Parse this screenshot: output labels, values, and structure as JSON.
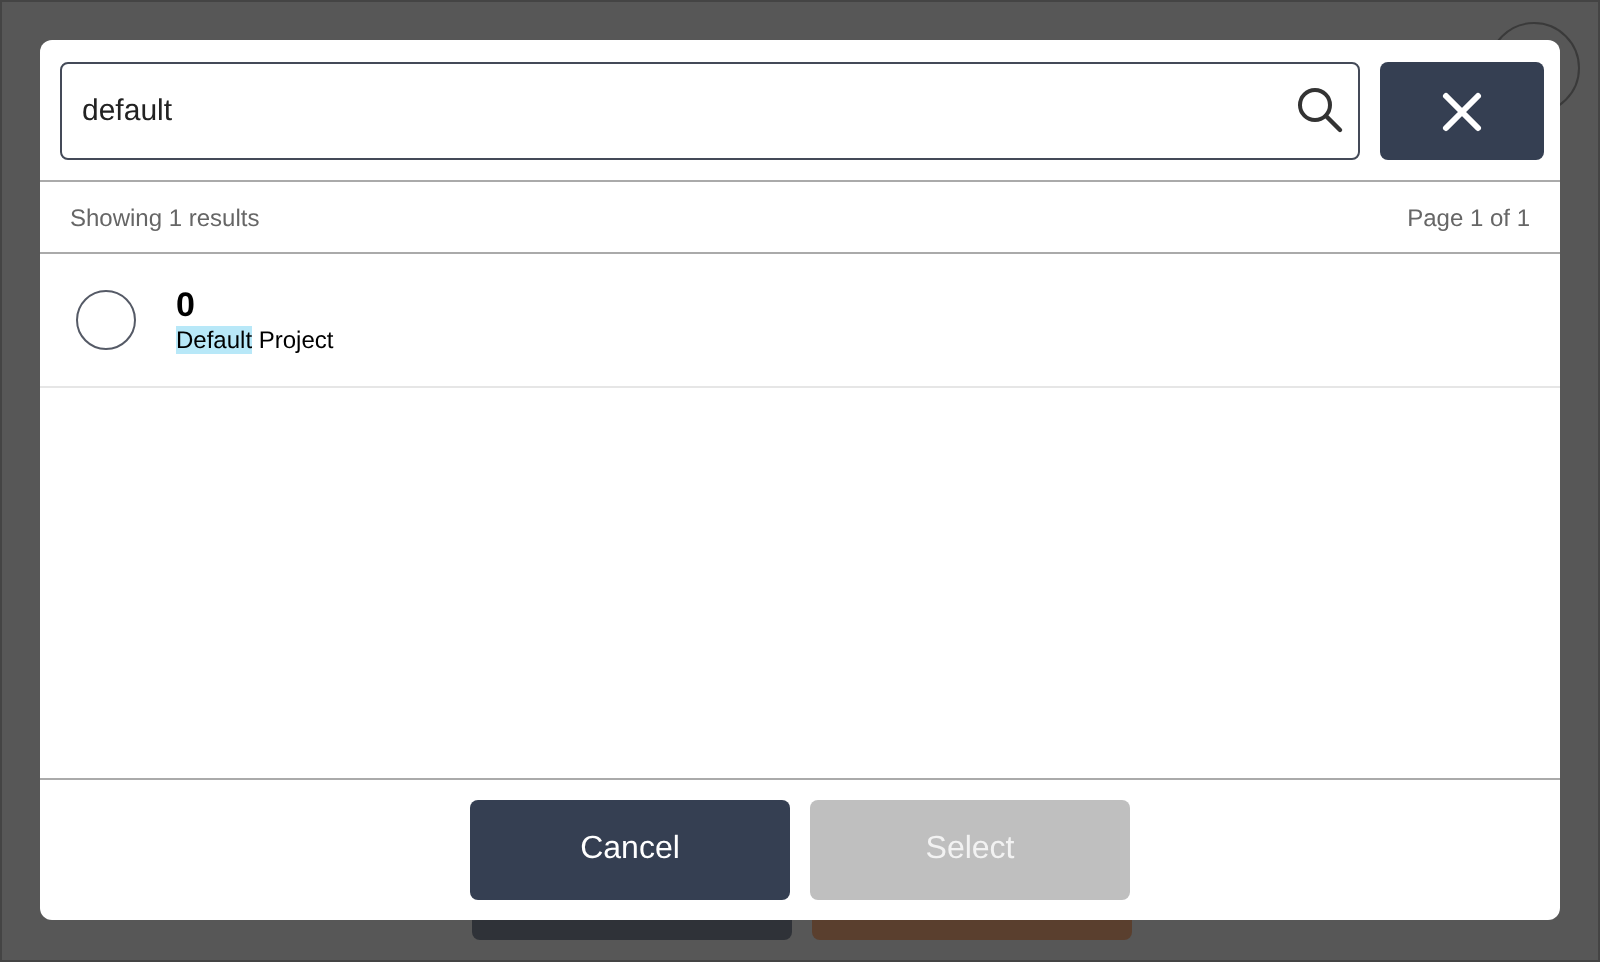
{
  "search": {
    "value": "default"
  },
  "summary": {
    "count_text": "Showing 1 results",
    "page_text": "Page 1 of 1"
  },
  "results": [
    {
      "code": "0",
      "name_match": "Default",
      "name_rest": " Project",
      "selected": false
    }
  ],
  "buttons": [
    {
      "label": "Cancel",
      "disabled": false
    },
    {
      "label": "Select",
      "disabled": true
    }
  ]
}
